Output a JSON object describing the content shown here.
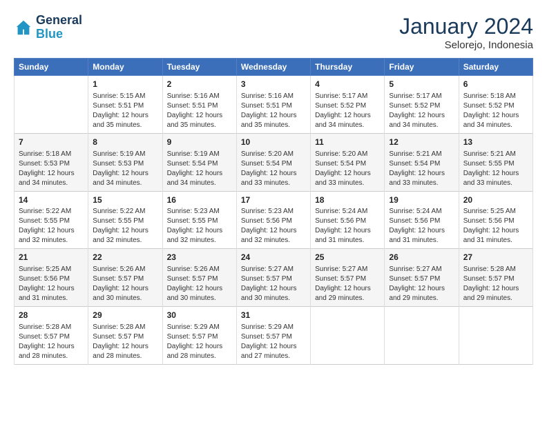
{
  "header": {
    "logo_line1": "General",
    "logo_line2": "Blue",
    "month": "January 2024",
    "location": "Selorejo, Indonesia"
  },
  "days_of_week": [
    "Sunday",
    "Monday",
    "Tuesday",
    "Wednesday",
    "Thursday",
    "Friday",
    "Saturday"
  ],
  "weeks": [
    [
      {
        "day": "",
        "info": ""
      },
      {
        "day": "1",
        "info": "Sunrise: 5:15 AM\nSunset: 5:51 PM\nDaylight: 12 hours\nand 35 minutes."
      },
      {
        "day": "2",
        "info": "Sunrise: 5:16 AM\nSunset: 5:51 PM\nDaylight: 12 hours\nand 35 minutes."
      },
      {
        "day": "3",
        "info": "Sunrise: 5:16 AM\nSunset: 5:51 PM\nDaylight: 12 hours\nand 35 minutes."
      },
      {
        "day": "4",
        "info": "Sunrise: 5:17 AM\nSunset: 5:52 PM\nDaylight: 12 hours\nand 34 minutes."
      },
      {
        "day": "5",
        "info": "Sunrise: 5:17 AM\nSunset: 5:52 PM\nDaylight: 12 hours\nand 34 minutes."
      },
      {
        "day": "6",
        "info": "Sunrise: 5:18 AM\nSunset: 5:52 PM\nDaylight: 12 hours\nand 34 minutes."
      }
    ],
    [
      {
        "day": "7",
        "info": "Sunrise: 5:18 AM\nSunset: 5:53 PM\nDaylight: 12 hours\nand 34 minutes."
      },
      {
        "day": "8",
        "info": "Sunrise: 5:19 AM\nSunset: 5:53 PM\nDaylight: 12 hours\nand 34 minutes."
      },
      {
        "day": "9",
        "info": "Sunrise: 5:19 AM\nSunset: 5:54 PM\nDaylight: 12 hours\nand 34 minutes."
      },
      {
        "day": "10",
        "info": "Sunrise: 5:20 AM\nSunset: 5:54 PM\nDaylight: 12 hours\nand 33 minutes."
      },
      {
        "day": "11",
        "info": "Sunrise: 5:20 AM\nSunset: 5:54 PM\nDaylight: 12 hours\nand 33 minutes."
      },
      {
        "day": "12",
        "info": "Sunrise: 5:21 AM\nSunset: 5:54 PM\nDaylight: 12 hours\nand 33 minutes."
      },
      {
        "day": "13",
        "info": "Sunrise: 5:21 AM\nSunset: 5:55 PM\nDaylight: 12 hours\nand 33 minutes."
      }
    ],
    [
      {
        "day": "14",
        "info": "Sunrise: 5:22 AM\nSunset: 5:55 PM\nDaylight: 12 hours\nand 32 minutes."
      },
      {
        "day": "15",
        "info": "Sunrise: 5:22 AM\nSunset: 5:55 PM\nDaylight: 12 hours\nand 32 minutes."
      },
      {
        "day": "16",
        "info": "Sunrise: 5:23 AM\nSunset: 5:55 PM\nDaylight: 12 hours\nand 32 minutes."
      },
      {
        "day": "17",
        "info": "Sunrise: 5:23 AM\nSunset: 5:56 PM\nDaylight: 12 hours\nand 32 minutes."
      },
      {
        "day": "18",
        "info": "Sunrise: 5:24 AM\nSunset: 5:56 PM\nDaylight: 12 hours\nand 31 minutes."
      },
      {
        "day": "19",
        "info": "Sunrise: 5:24 AM\nSunset: 5:56 PM\nDaylight: 12 hours\nand 31 minutes."
      },
      {
        "day": "20",
        "info": "Sunrise: 5:25 AM\nSunset: 5:56 PM\nDaylight: 12 hours\nand 31 minutes."
      }
    ],
    [
      {
        "day": "21",
        "info": "Sunrise: 5:25 AM\nSunset: 5:56 PM\nDaylight: 12 hours\nand 31 minutes."
      },
      {
        "day": "22",
        "info": "Sunrise: 5:26 AM\nSunset: 5:57 PM\nDaylight: 12 hours\nand 30 minutes."
      },
      {
        "day": "23",
        "info": "Sunrise: 5:26 AM\nSunset: 5:57 PM\nDaylight: 12 hours\nand 30 minutes."
      },
      {
        "day": "24",
        "info": "Sunrise: 5:27 AM\nSunset: 5:57 PM\nDaylight: 12 hours\nand 30 minutes."
      },
      {
        "day": "25",
        "info": "Sunrise: 5:27 AM\nSunset: 5:57 PM\nDaylight: 12 hours\nand 29 minutes."
      },
      {
        "day": "26",
        "info": "Sunrise: 5:27 AM\nSunset: 5:57 PM\nDaylight: 12 hours\nand 29 minutes."
      },
      {
        "day": "27",
        "info": "Sunrise: 5:28 AM\nSunset: 5:57 PM\nDaylight: 12 hours\nand 29 minutes."
      }
    ],
    [
      {
        "day": "28",
        "info": "Sunrise: 5:28 AM\nSunset: 5:57 PM\nDaylight: 12 hours\nand 28 minutes."
      },
      {
        "day": "29",
        "info": "Sunrise: 5:28 AM\nSunset: 5:57 PM\nDaylight: 12 hours\nand 28 minutes."
      },
      {
        "day": "30",
        "info": "Sunrise: 5:29 AM\nSunset: 5:57 PM\nDaylight: 12 hours\nand 28 minutes."
      },
      {
        "day": "31",
        "info": "Sunrise: 5:29 AM\nSunset: 5:57 PM\nDaylight: 12 hours\nand 27 minutes."
      },
      {
        "day": "",
        "info": ""
      },
      {
        "day": "",
        "info": ""
      },
      {
        "day": "",
        "info": ""
      }
    ]
  ]
}
